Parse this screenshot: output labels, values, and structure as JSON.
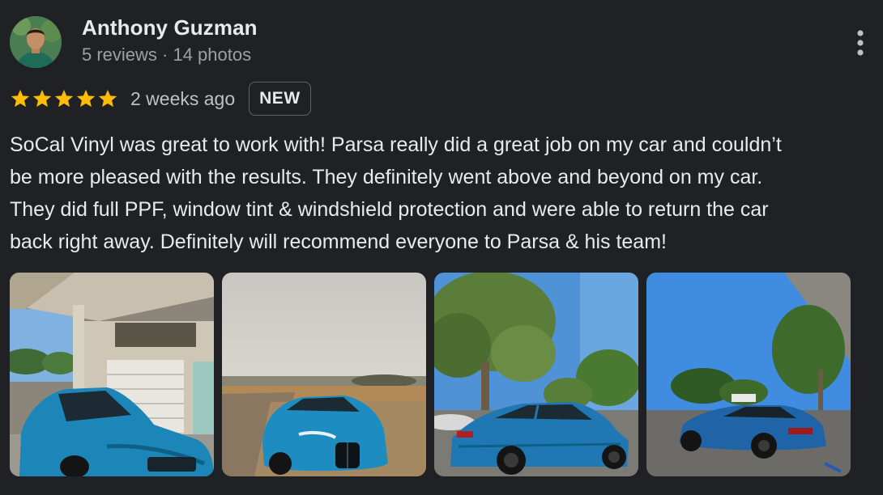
{
  "author": {
    "name": "Anthony Guzman",
    "meta": "5 reviews · 14 photos"
  },
  "review": {
    "rating": 5,
    "rating_max": 5,
    "time_ago": "2 weeks ago",
    "badge": "NEW",
    "text_lines": [
      "SoCal Vinyl was great to work with! Parsa really did a great job on my car and couldn’t",
      "be more pleased with the results. They definitely went above and beyond on my car.",
      "They did full PPF, window tint & windshield protection and were able to return the car",
      "back right away. Definitely will recommend everyone to Parsa & his team!"
    ]
  },
  "photos": [
    {
      "name": "photo-car-in-garage"
    },
    {
      "name": "photo-car-front-hill"
    },
    {
      "name": "photo-car-side-trees"
    },
    {
      "name": "photo-car-rear-parking"
    }
  ],
  "icons": {
    "star": "star-icon",
    "menu": "more-vert-icon"
  },
  "colors": {
    "background": "#202124",
    "star": "#fbbc04",
    "car_blue": "#1f7fb3",
    "text_primary": "#e8eaed",
    "text_secondary": "#9aa0a6"
  }
}
